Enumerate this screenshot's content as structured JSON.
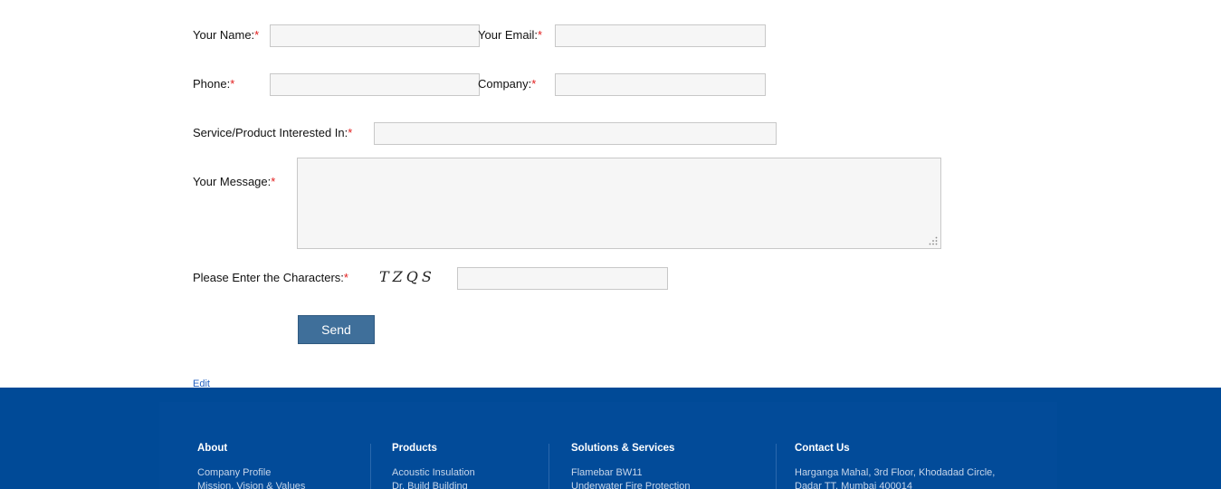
{
  "form": {
    "name_label": "Your Name:",
    "email_label": "Your Email:",
    "phone_label": "Phone:",
    "company_label": "Company:",
    "service_label": "Service/Product Interested In:",
    "message_label": "Your Message:",
    "captcha_label": "Please Enter the Characters:",
    "required_mark": "*",
    "captcha_text": "TZQS",
    "send_label": "Send",
    "edit_label": "Edit"
  },
  "footer": {
    "columns": [
      {
        "heading": "About",
        "line1": "Company Profile",
        "line2": "Mission, Vision & Values"
      },
      {
        "heading": "Products",
        "line1": "Acoustic Insulation",
        "line2": "Dr. Build Building"
      },
      {
        "heading": "Solutions & Services",
        "line1": "Flamebar BW11",
        "line2": "Underwater Fire Protection"
      },
      {
        "heading": "Contact Us",
        "line1": "Harganga Mahal, 3rd Floor, Khodadad Circle,",
        "line2": "Dadar TT, Mumbai 400014"
      }
    ]
  },
  "colors": {
    "footer_bg": "#004a97",
    "button_bg": "#3f6f9a",
    "required": "#e21d1d",
    "link": "#2462c2"
  }
}
